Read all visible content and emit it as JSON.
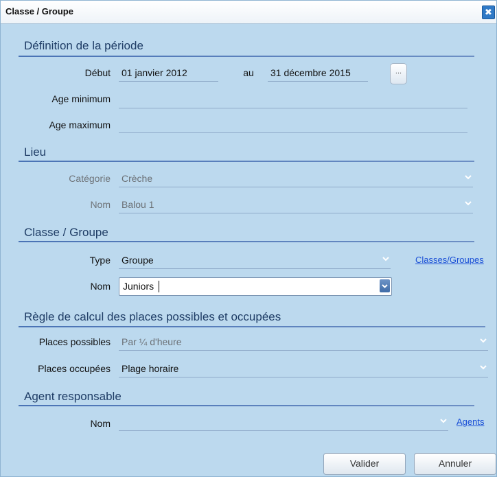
{
  "window": {
    "title": "Classe / Groupe",
    "close": "✖"
  },
  "periode": {
    "heading": "Définition de la période",
    "debut_label": "Début",
    "debut_value": "01 janvier 2012",
    "au_label": "au",
    "fin_value": "31 décembre 2015",
    "picker_label": "...",
    "age_min_label": "Age minimum",
    "age_min_value": "",
    "age_max_label": "Age maximum",
    "age_max_value": ""
  },
  "lieu": {
    "heading": "Lieu",
    "categorie_label": "Catégorie",
    "categorie_value": "Crèche",
    "nom_label": "Nom",
    "nom_value": "Balou 1"
  },
  "classe": {
    "heading": "Classe / Groupe",
    "type_label": "Type",
    "type_value": "Groupe",
    "link": "Classes/Groupes",
    "nom_label": "Nom",
    "nom_value": "Juniors"
  },
  "regle": {
    "heading": "Règle de calcul des places possibles et occupées",
    "possibles_label": "Places possibles",
    "possibles_value": "Par ¼ d'heure",
    "occupees_label": "Places occupées",
    "occupees_value": "Plage horaire"
  },
  "agent": {
    "heading": "Agent responsable",
    "nom_label": "Nom",
    "nom_value": "",
    "link": "Agents"
  },
  "buttons": {
    "valider": "Valider",
    "annuler": "Annuler"
  }
}
